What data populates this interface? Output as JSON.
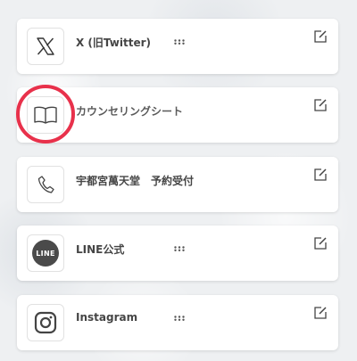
{
  "links": [
    {
      "title": "X (旧Twitter)",
      "icon": "x-logo-icon"
    },
    {
      "title": "カウンセリングシート",
      "icon": "book-icon"
    },
    {
      "title": "宇都宮萬天堂　予約受付",
      "icon": "phone-icon"
    },
    {
      "title": "LINE公式",
      "icon": "line-logo-icon",
      "badge_text": "LINE"
    },
    {
      "title": "Instagram",
      "icon": "instagram-icon"
    }
  ],
  "colors": {
    "highlight_circle": "#e8314b",
    "text": "#454545"
  }
}
